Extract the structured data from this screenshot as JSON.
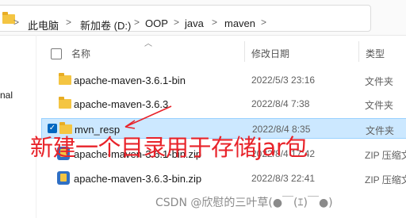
{
  "breadcrumb": {
    "items": [
      "此电脑",
      "新加卷 (D:)",
      "OOP",
      "java",
      "maven"
    ],
    "separator": ">"
  },
  "nav_fragment": "nal",
  "columns": {
    "name": "名称",
    "modified": "修改日期",
    "type": "类型"
  },
  "files": [
    {
      "name": "apache-maven-3.6.1-bin",
      "date": "2022/5/3 23:16",
      "type": "文件夹",
      "icon": "folder-icon"
    },
    {
      "name": "apache-maven-3.6.3",
      "date": "2022/8/4 7:38",
      "type": "文件夹",
      "icon": "folder-icon"
    },
    {
      "name": "mvn_resp",
      "date": "2022/8/4 8:35",
      "type": "文件夹",
      "icon": "folder-icon",
      "selected": true
    },
    {
      "name": "apache-maven-3.6.1-bin.zip",
      "date": "2022/8/4 17:42",
      "type": "ZIP 压缩文",
      "icon": "zip-icon"
    },
    {
      "name": "apache-maven-3.6.3-bin.zip",
      "date": "2022/8/3 22:41",
      "type": "ZIP 压缩文",
      "icon": "zip-icon"
    }
  ],
  "annotation": "新建一个目录用于存储jar包",
  "watermark": "CSDN @欣慰的三叶草(●￣(ｴ)￣●)",
  "colors": {
    "annotation": "#e8232a",
    "selection": "#cce8ff",
    "folder": "#f4c542"
  }
}
